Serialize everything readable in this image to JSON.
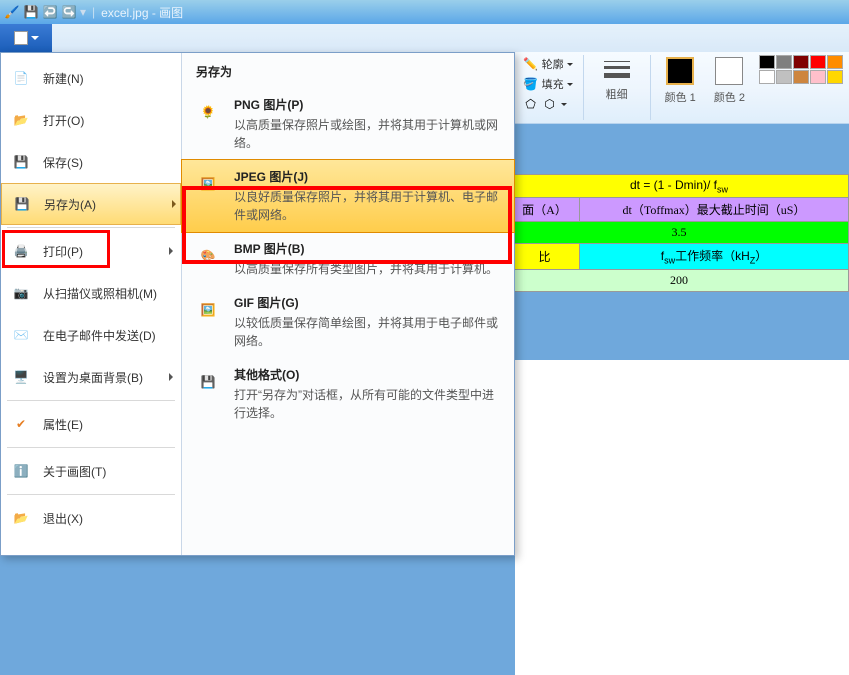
{
  "title": {
    "text": "excel.jpg - 画图"
  },
  "qat": {
    "save": "save-icon",
    "undo": "undo-icon",
    "redo": "redo-icon"
  },
  "ribbon": {
    "outline": "轮廓",
    "fill": "填充",
    "thick_lbl": "粗细",
    "color1_lbl": "颜色 1",
    "color2_lbl": "颜色 2",
    "colors": [
      "#000",
      "#7f7f7f",
      "#800000",
      "#f00",
      "#ff8c00",
      "#fff",
      "#c0c0c0",
      "#cd853f",
      "#ffc0cb",
      "#ffd700"
    ]
  },
  "fileMenu": {
    "items": [
      {
        "label": "新建(N)",
        "icon": "new"
      },
      {
        "label": "打开(O)",
        "icon": "open"
      },
      {
        "label": "保存(S)",
        "icon": "save"
      },
      {
        "label": "另存为(A)",
        "icon": "saveas",
        "active": true
      },
      {
        "label": "打印(P)",
        "icon": "print",
        "sub": true
      },
      {
        "label": "从扫描仪或照相机(M)",
        "icon": "scanner"
      },
      {
        "label": "在电子邮件中发送(D)",
        "icon": "email"
      },
      {
        "label": "设置为桌面背景(B)",
        "icon": "desktop",
        "sub": true
      },
      {
        "label": "属性(E)",
        "icon": "props"
      },
      {
        "label": "关于画图(T)",
        "icon": "about"
      },
      {
        "label": "退出(X)",
        "icon": "exit"
      }
    ],
    "panelTitle": "另存为",
    "subs": [
      {
        "title": "PNG 图片(P)",
        "desc": "以高质量保存照片或绘图，并将其用于计算机或网络。",
        "icon": "png"
      },
      {
        "title": "JPEG 图片(J)",
        "desc": "以良好质量保存照片，并将其用于计算机、电子邮件或网络。",
        "icon": "jpeg",
        "hl": true
      },
      {
        "title": "BMP 图片(B)",
        "desc": "以高质量保存所有类型图片，并将其用于计算机。",
        "icon": "bmp"
      },
      {
        "title": "GIF 图片(G)",
        "desc": "以较低质量保存简单绘图，并将其用于电子邮件或网络。",
        "icon": "gif"
      },
      {
        "title": "其他格式(O)",
        "desc": "打开“另存为”对话框，从所有可能的文件类型中进行选择。",
        "icon": "other"
      }
    ]
  },
  "sheet": {
    "r1a": "dt = (1 - Dmin)/ f",
    "r1a_sub": "sw",
    "r2a": "面（A）",
    "r2b": "dt（Toffmax）最大截止时间（uS）",
    "r3a": "3.5",
    "r4a": "比",
    "r4b": "f",
    "r4b_sub": "sw",
    "r4b_rest": "工作频率（kH",
    "r4b_sub2": "Z",
    "r4b_end": "）",
    "r5a": "200"
  }
}
